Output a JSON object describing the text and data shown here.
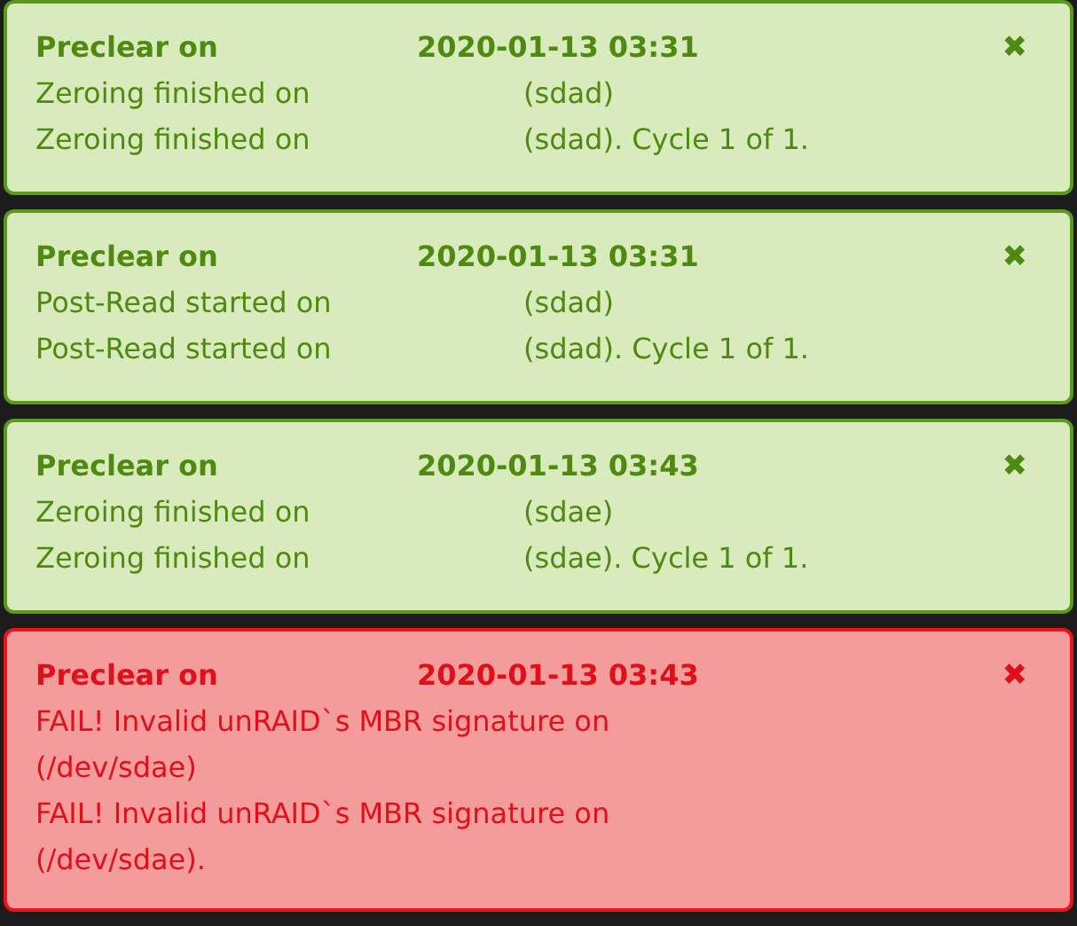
{
  "notifications": [
    {
      "kind": "success",
      "title": "Preclear on",
      "time": "2020-01-13 03:31",
      "close": "✖",
      "lines": [
        {
          "text": "Zeroing finished on",
          "device": "(sdad)"
        },
        {
          "text": "Zeroing finished on",
          "device": "(sdad). Cycle 1 of 1."
        }
      ]
    },
    {
      "kind": "success",
      "title": "Preclear on",
      "time": "2020-01-13 03:31",
      "close": "✖",
      "lines": [
        {
          "text": "Post-Read started on",
          "device": "(sdad)"
        },
        {
          "text": "Post-Read started on",
          "device": "(sdad). Cycle 1 of 1."
        }
      ]
    },
    {
      "kind": "success",
      "title": "Preclear on",
      "time": "2020-01-13 03:43",
      "close": "✖",
      "lines": [
        {
          "text": "Zeroing finished on",
          "device": "(sdae)"
        },
        {
          "text": "Zeroing finished on",
          "device": "(sdae). Cycle 1 of 1."
        }
      ]
    },
    {
      "kind": "error",
      "title": "Preclear on",
      "time": "2020-01-13 03:43",
      "close": "✖",
      "lines": [
        {
          "text": "FAIL! Invalid unRAID`s MBR signature on",
          "device": "(/dev/sdae)"
        },
        {
          "text": "FAIL! Invalid unRAID`s MBR signature on",
          "device": "(/dev/sdae)."
        }
      ]
    }
  ]
}
